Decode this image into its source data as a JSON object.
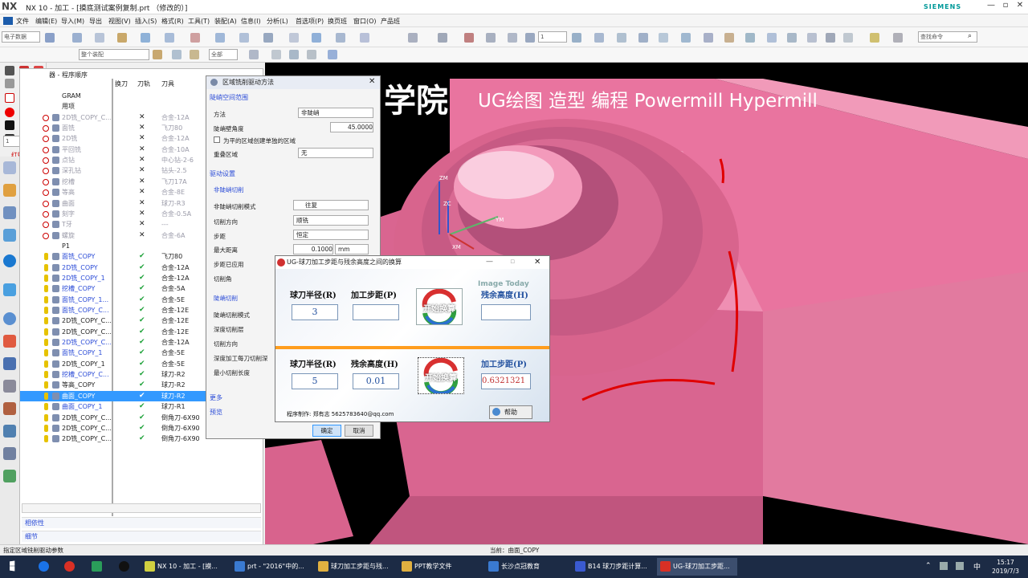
{
  "window": {
    "logo": "NX",
    "title": "NX 10 - 加工 - [摸底测试案例复制.prt （修改的）]",
    "brand": "SIEMENS"
  },
  "menu": [
    "文件",
    "编辑(E)",
    "导入(M)",
    "导出",
    "视图(V)",
    "插入(S)",
    "格式(R)",
    "工具(T)",
    "装配(A)",
    "信息(I)",
    "分析(L)",
    "首选项(P)",
    "换页班",
    "窗口(O)",
    "产品班"
  ],
  "toolbar": {
    "combo1": "电子数据",
    "combo2": "整个装配",
    "combo3": "全部",
    "layer": "1",
    "search_placeholder": "查找命令"
  },
  "left_sidebar": {
    "label": "红蜘软件",
    "layer_value": "1"
  },
  "nav": {
    "panel_title": "器 - 程序顺序",
    "columns": [
      "换刀",
      "刀轨",
      "刀具"
    ],
    "rows": [
      {
        "name": "GRAM",
        "tool": "",
        "mark": "",
        "style": "normal"
      },
      {
        "name": "用项",
        "tool": "",
        "mark": "",
        "style": "normal"
      },
      {
        "name": "2D铣_COPY_C...",
        "tool": "合金-12A",
        "mark": "x",
        "style": "grey"
      },
      {
        "name": "面铣",
        "tool": "飞刀80",
        "mark": "x",
        "style": "grey"
      },
      {
        "name": "2D铣",
        "tool": "合金-12A",
        "mark": "x",
        "style": "grey"
      },
      {
        "name": "平回铣",
        "tool": "合金-10A",
        "mark": "x",
        "style": "grey"
      },
      {
        "name": "点钻",
        "tool": "中心钻-2-6",
        "mark": "x",
        "style": "grey"
      },
      {
        "name": "深孔钻",
        "tool": "钻头-2.5",
        "mark": "x",
        "style": "grey"
      },
      {
        "name": "挖槽",
        "tool": "飞刀17A",
        "mark": "x",
        "style": "grey"
      },
      {
        "name": "等高",
        "tool": "合金-8E",
        "mark": "x",
        "style": "grey"
      },
      {
        "name": "曲面",
        "tool": "球刀-R3",
        "mark": "x",
        "style": "grey"
      },
      {
        "name": "刻字",
        "tool": "合金-0.5A",
        "mark": "x",
        "style": "grey"
      },
      {
        "name": "T牙",
        "tool": "---",
        "mark": "x",
        "style": "grey"
      },
      {
        "name": "螺旋",
        "tool": "合金-6A",
        "mark": "x",
        "style": "grey"
      },
      {
        "name": "P1",
        "tool": "",
        "mark": "",
        "style": "normal"
      },
      {
        "name": "面铣_COPY",
        "tool": "飞刀80",
        "mark": "ok",
        "style": "blue"
      },
      {
        "name": "2D铣_COPY",
        "tool": "合金-12A",
        "mark": "ok",
        "style": "blue"
      },
      {
        "name": "2D铣_COPY_1",
        "tool": "合金-12A",
        "mark": "ok",
        "style": "blue"
      },
      {
        "name": "挖槽_COPY",
        "tool": "合金-5A",
        "mark": "ok",
        "style": "blue"
      },
      {
        "name": "面铣_COPY_1...",
        "tool": "合金-5E",
        "mark": "ok",
        "style": "blue"
      },
      {
        "name": "面铣_COPY_C...",
        "tool": "合金-12E",
        "mark": "ok",
        "style": "blue"
      },
      {
        "name": "2D铣_COPY_C...",
        "tool": "合金-12E",
        "mark": "ok",
        "style": "normal"
      },
      {
        "name": "2D铣_COPY_C...",
        "tool": "合金-12E",
        "mark": "ok",
        "style": "normal"
      },
      {
        "name": "2D铣_COPY_C...",
        "tool": "合金-12A",
        "mark": "ok",
        "style": "blue"
      },
      {
        "name": "面铣_COPY_1",
        "tool": "合金-5E",
        "mark": "ok",
        "style": "blue"
      },
      {
        "name": "2D铣_COPY_1",
        "tool": "合金-5E",
        "mark": "ok",
        "style": "normal"
      },
      {
        "name": "挖槽_COPY_C...",
        "tool": "球刀-R2",
        "mark": "ok",
        "style": "blue"
      },
      {
        "name": "等高_COPY",
        "tool": "球刀-R2",
        "mark": "ok",
        "style": "normal"
      },
      {
        "name": "曲面_COPY",
        "tool": "球刀-R2",
        "mark": "ok",
        "style": "selected"
      },
      {
        "name": "曲面_COPY_1",
        "tool": "球刀-R1",
        "mark": "ok",
        "style": "blue"
      },
      {
        "name": "2D铣_COPY_C...",
        "tool": "倒角刀-6X90",
        "mark": "ok",
        "style": "normal"
      },
      {
        "name": "2D铣_COPY_C...",
        "tool": "倒角刀-6X90",
        "mark": "ok",
        "style": "normal"
      },
      {
        "name": "2D铣_COPY_C...",
        "tool": "倒角刀-6X90",
        "mark": "ok",
        "style": "normal"
      }
    ],
    "section_dependency": "相依性",
    "section_detail": "细节"
  },
  "viewport": {
    "title": "学院",
    "subtitle": "UG绘图 造型 编程 Powermill Hypermill",
    "axis_zm": "ZM",
    "axis_zc": "ZC",
    "axis_ym": "YM",
    "axis_xm": "XM"
  },
  "drive_dialog": {
    "title": "区域铣削驱动方法",
    "sec_steep": "陡峭空间范围",
    "method_label": "方法",
    "method_value": "非陡峭",
    "angle_label": "陡峭壁角度",
    "angle_value": "45.0000",
    "flat_checkbox": "为平的区域创建单独的区域",
    "overlap_label": "重叠区域",
    "overlap_value": "无",
    "sec_drive": "驱动设置",
    "sub_nonsteep": "非陡峭切削",
    "pattern_label": "非陡峭切削模式",
    "pattern_value": "往复",
    "dir_label": "切削方向",
    "dir_value": "顺铣",
    "step_label": "步距",
    "step_value": "恒定",
    "maxdist_label": "最大距离",
    "maxdist_value": "0.1000",
    "maxdist_unit": "mm",
    "applied_label": "步距已应用",
    "angle2_label": "切削角",
    "sub_steep": "陡峭切削",
    "steep_mode_label": "陡峭切削模式",
    "depth_label": "深度切削层",
    "dir2_label": "切削方向",
    "depth_tool_label": "深度加工每刀切削深",
    "min_len_label": "最小切削长度",
    "sec_more": "更多",
    "sec_preview": "预览",
    "ok": "确定",
    "cancel": "取消"
  },
  "calc_dialog": {
    "title": "UG-球刀加工步距与残余高度之间的换算",
    "label_radius1": "球刀半径(R)",
    "label_step1": "加工步距(P)",
    "label_height1": "残余高度(H)",
    "radius1": "3",
    "step1": "",
    "height1": "",
    "btn_start1": "开始换算",
    "label_radius2": "球刀半径(R)",
    "label_height2": "残余高度(H)",
    "label_step2": "加工步距(P)",
    "radius2": "5",
    "height2": "0.01",
    "step2": "0.6321321",
    "btn_start2": "开始换算",
    "watermark": "Image Today",
    "author": "程序制作: 郑有志 5625783640@qq.com",
    "help": "帮助"
  },
  "status": {
    "left": "指定区域铣削驱动参数",
    "center": "当前：曲面_COPY"
  },
  "taskbar": {
    "items": [
      "NX 10 - 加工 - [摸...",
      "prt - \"2016\"中的...",
      "球刀加工步距与残...",
      "PPT教学文件",
      "长沙点冠教育",
      "B14 球刀步距计算...",
      "UG-球刀加工步距..."
    ],
    "time": "15:17",
    "date": "2019/7/3",
    "ime": "中"
  },
  "colors": {
    "model_pink": "#e9749f",
    "selection_blue": "#3399ff",
    "taskbar": "#1c2b45",
    "orange_divider": "#ff9d1e",
    "markup_red": "#e00000"
  }
}
